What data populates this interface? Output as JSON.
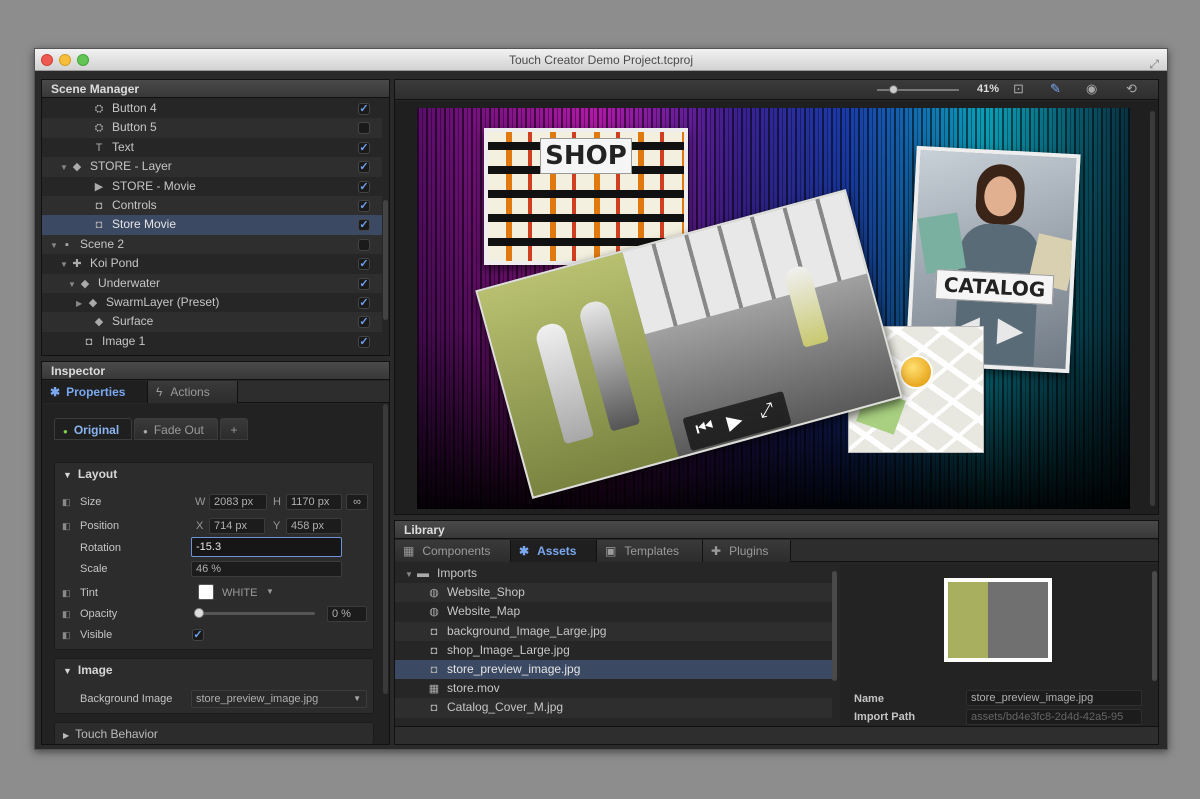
{
  "window": {
    "title": "Touch Creator Demo Project.tcproj"
  },
  "scene_manager": {
    "title": "Scene Manager",
    "items": [
      {
        "label": "Button 4",
        "icon": "button-icon",
        "glyph": "⛭",
        "indent": 40,
        "tri": "",
        "checked": true
      },
      {
        "label": "Button 5",
        "icon": "button-icon",
        "glyph": "⛭",
        "indent": 40,
        "tri": "",
        "checked": false
      },
      {
        "label": "Text",
        "icon": "text-icon",
        "glyph": "T",
        "indent": 40,
        "tri": "",
        "checked": true
      },
      {
        "label": "STORE - Layer",
        "icon": "layer-icon",
        "glyph": "◆",
        "indent": 18,
        "tri": "▼",
        "checked": true
      },
      {
        "label": "STORE - Movie",
        "icon": "movie-icon",
        "glyph": "▶",
        "indent": 40,
        "tri": "",
        "checked": true
      },
      {
        "label": "Controls",
        "icon": "camera-icon",
        "glyph": "◘",
        "indent": 40,
        "tri": "",
        "checked": true
      },
      {
        "label": "Store Movie",
        "icon": "camera-icon",
        "glyph": "◘",
        "indent": 40,
        "tri": "",
        "checked": true,
        "selected": true
      },
      {
        "label": "Scene 2",
        "icon": "scene-icon",
        "glyph": "▪",
        "indent": 8,
        "tri": "▼",
        "checked": false
      },
      {
        "label": "Koi Pond",
        "icon": "group-icon",
        "glyph": "✚",
        "indent": 18,
        "tri": "▼",
        "checked": true
      },
      {
        "label": "Underwater",
        "icon": "layer-icon",
        "glyph": "◆",
        "indent": 26,
        "tri": "▼",
        "checked": true
      },
      {
        "label": "SwarmLayer (Preset)",
        "icon": "layer-icon",
        "glyph": "◆",
        "indent": 34,
        "tri": "▶",
        "checked": true
      },
      {
        "label": "Surface",
        "icon": "layer-icon",
        "glyph": "◆",
        "indent": 40,
        "tri": "",
        "checked": true
      },
      {
        "label": "Image 1",
        "icon": "camera-icon",
        "glyph": "◘",
        "indent": 30,
        "tri": "",
        "checked": true
      }
    ]
  },
  "inspector": {
    "title": "Inspector",
    "tabs": [
      {
        "label": "Properties"
      },
      {
        "label": "Actions"
      }
    ],
    "state_tabs": [
      {
        "label": "Original"
      },
      {
        "label": "Fade Out"
      },
      {
        "label": "+"
      }
    ],
    "layout": {
      "title": "Layout",
      "size_label": "Size",
      "w_label": "W",
      "w_value": "2083 px",
      "h_label": "H",
      "h_value": "1170 px",
      "position_label": "Position",
      "x_label": "X",
      "x_value": "714 px",
      "y_label": "Y",
      "y_value": "458 px",
      "rotation_label": "Rotation",
      "rotation_value": "-15.3",
      "scale_label": "Scale",
      "scale_value": "46 %",
      "tint_label": "Tint",
      "tint_value": "WHITE",
      "tint_color": "#ffffff",
      "opacity_label": "Opacity",
      "opacity_value": "0 %",
      "opacity_level": 0,
      "visible_label": "Visible",
      "visible_checked": true
    },
    "image": {
      "title": "Image",
      "bg_label": "Background Image",
      "bg_value": "store_preview_image.jpg"
    },
    "touch_behavior": {
      "title": "Touch Behavior"
    }
  },
  "toolbar": {
    "zoom": "41%",
    "zoom_level": 0.41
  },
  "stage": {
    "shop_text": "SHOP",
    "catalog_text": "CATALOG"
  },
  "library": {
    "title": "Library",
    "tabs": [
      {
        "label": "Components"
      },
      {
        "label": "Assets"
      },
      {
        "label": "Templates"
      },
      {
        "label": "Plugins"
      }
    ],
    "folder": "Imports",
    "items": [
      {
        "label": "Website_Shop",
        "icon": "globe-icon",
        "glyph": "◍"
      },
      {
        "label": "Website_Map",
        "icon": "globe-icon",
        "glyph": "◍"
      },
      {
        "label": "background_Image_Large.jpg",
        "icon": "camera-icon",
        "glyph": "◘"
      },
      {
        "label": "shop_Image_Large.jpg",
        "icon": "camera-icon",
        "glyph": "◘"
      },
      {
        "label": "store_preview_image.jpg",
        "icon": "camera-icon",
        "glyph": "◘",
        "selected": true
      },
      {
        "label": "store.mov",
        "icon": "film-icon",
        "glyph": "▦"
      },
      {
        "label": "Catalog_Cover_M.jpg",
        "icon": "camera-icon",
        "glyph": "◘"
      }
    ],
    "preview": {
      "name_label": "Name",
      "name_value": "store_preview_image.jpg",
      "path_label": "Import Path",
      "path_value": "assets/bd4e3fc8-2d4d-42a5-95"
    }
  }
}
